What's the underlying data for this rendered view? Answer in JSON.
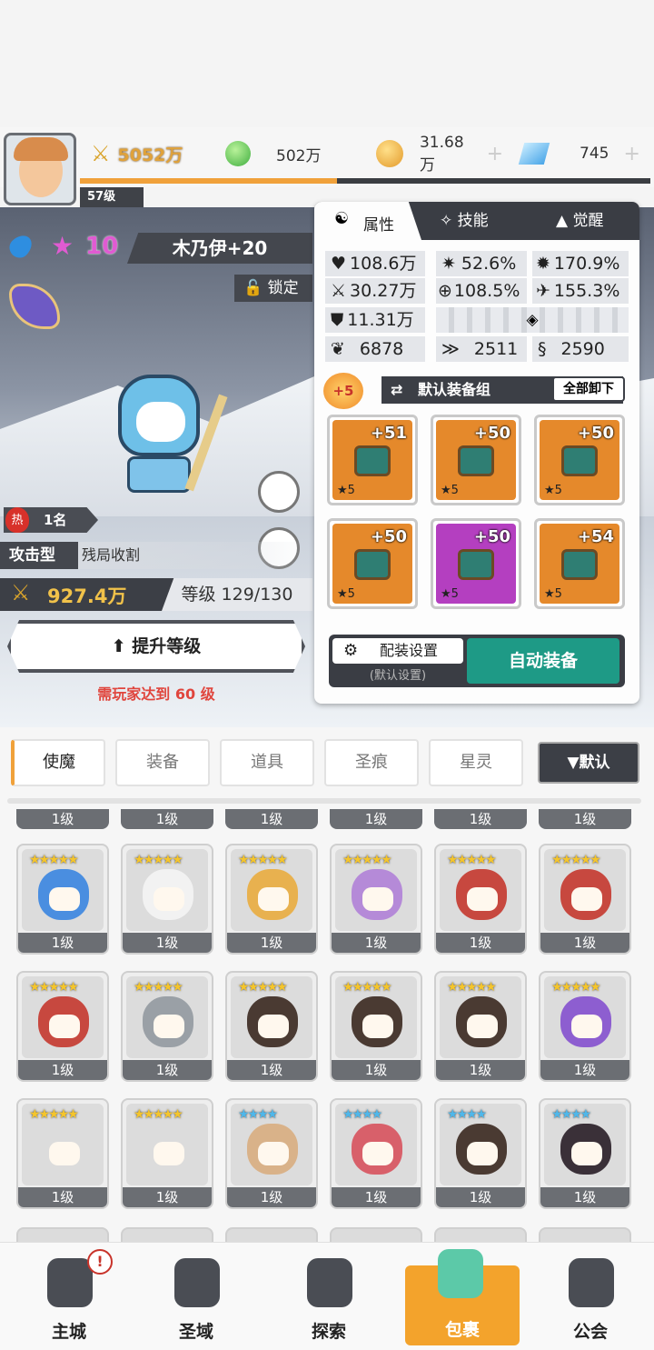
{
  "header": {
    "power": "5052万",
    "coin1": "502万",
    "coin2": "31.68万",
    "gem": "745",
    "player_level": "57级"
  },
  "hero": {
    "element": "水",
    "stars": "10",
    "name": "木乃伊+20",
    "lock": "锁定",
    "hot_rank": "1名",
    "hot_label": "热",
    "type": "攻击型",
    "trait": "残局收割",
    "power": "927.4万",
    "level": "等级 129/130",
    "upgrade": "提升等级",
    "requirement": "需玩家达到 60 级",
    "xp": 0.45
  },
  "panel": {
    "tabs": [
      "属性",
      "技能",
      "觉醒"
    ],
    "stats": [
      [
        "108.6万",
        "52.6%",
        "170.9%"
      ],
      [
        "30.27万",
        "108.5%",
        "155.3%"
      ],
      [
        "11.31万"
      ],
      [
        "6878",
        "2511",
        "2590"
      ]
    ],
    "equip_bonus": "+5",
    "equip_set": "默认装备组",
    "unequip_all": "全部卸下",
    "equips": [
      {
        "lvl": "+51",
        "stars": "★5",
        "color": "#e5892b"
      },
      {
        "lvl": "+50",
        "stars": "★5",
        "color": "#e5892b"
      },
      {
        "lvl": "+50",
        "stars": "★5",
        "color": "#e5892b"
      },
      {
        "lvl": "+50",
        "stars": "★5",
        "color": "#e5892b"
      },
      {
        "lvl": "+50",
        "stars": "★5",
        "color": "#b43fc0"
      },
      {
        "lvl": "+54",
        "stars": "★5",
        "color": "#e5892b"
      }
    ],
    "config": "配装设置",
    "config_sub": "(默认设置)",
    "auto": "自动装备"
  },
  "categories": [
    "使魔",
    "装备",
    "道具",
    "圣痕",
    "星灵"
  ],
  "sort": "▼默认",
  "level_text": "1级",
  "cards": [
    {
      "stars": "★★★★★",
      "color": "#4a8ee0"
    },
    {
      "stars": "★★★★★",
      "color": "#f2f2f2"
    },
    {
      "stars": "★★★★★",
      "color": "#e8b14f"
    },
    {
      "stars": "★★★★★",
      "color": "#b58ad8"
    },
    {
      "stars": "★★★★★",
      "color": "#c7483f"
    },
    {
      "stars": "★★★★★",
      "color": "#c7483f"
    },
    {
      "stars": "★★★★★",
      "color": "#c7483f"
    },
    {
      "stars": "★★★★★",
      "color": "#9aa0a6"
    },
    {
      "stars": "★★★★★",
      "color": "#4a3a32"
    },
    {
      "stars": "★★★★★",
      "color": "#4a3a32"
    },
    {
      "stars": "★★★★★",
      "color": "#4a3a32"
    },
    {
      "stars": "★★★★★",
      "color": "#8d5ed0"
    },
    {
      "stars": "★★★★★",
      "color": "#dcdcdc"
    },
    {
      "stars": "★★★★★",
      "color": "#dcdcdc"
    },
    {
      "stars": "★★★★",
      "color": "#d9b289"
    },
    {
      "stars": "★★★★",
      "color": "#d8606a"
    },
    {
      "stars": "★★★★",
      "color": "#4a3a32"
    },
    {
      "stars": "★★★★",
      "color": "#3a3038"
    }
  ],
  "nav": [
    "主城",
    "圣域",
    "探索",
    "包裹",
    "公会"
  ]
}
